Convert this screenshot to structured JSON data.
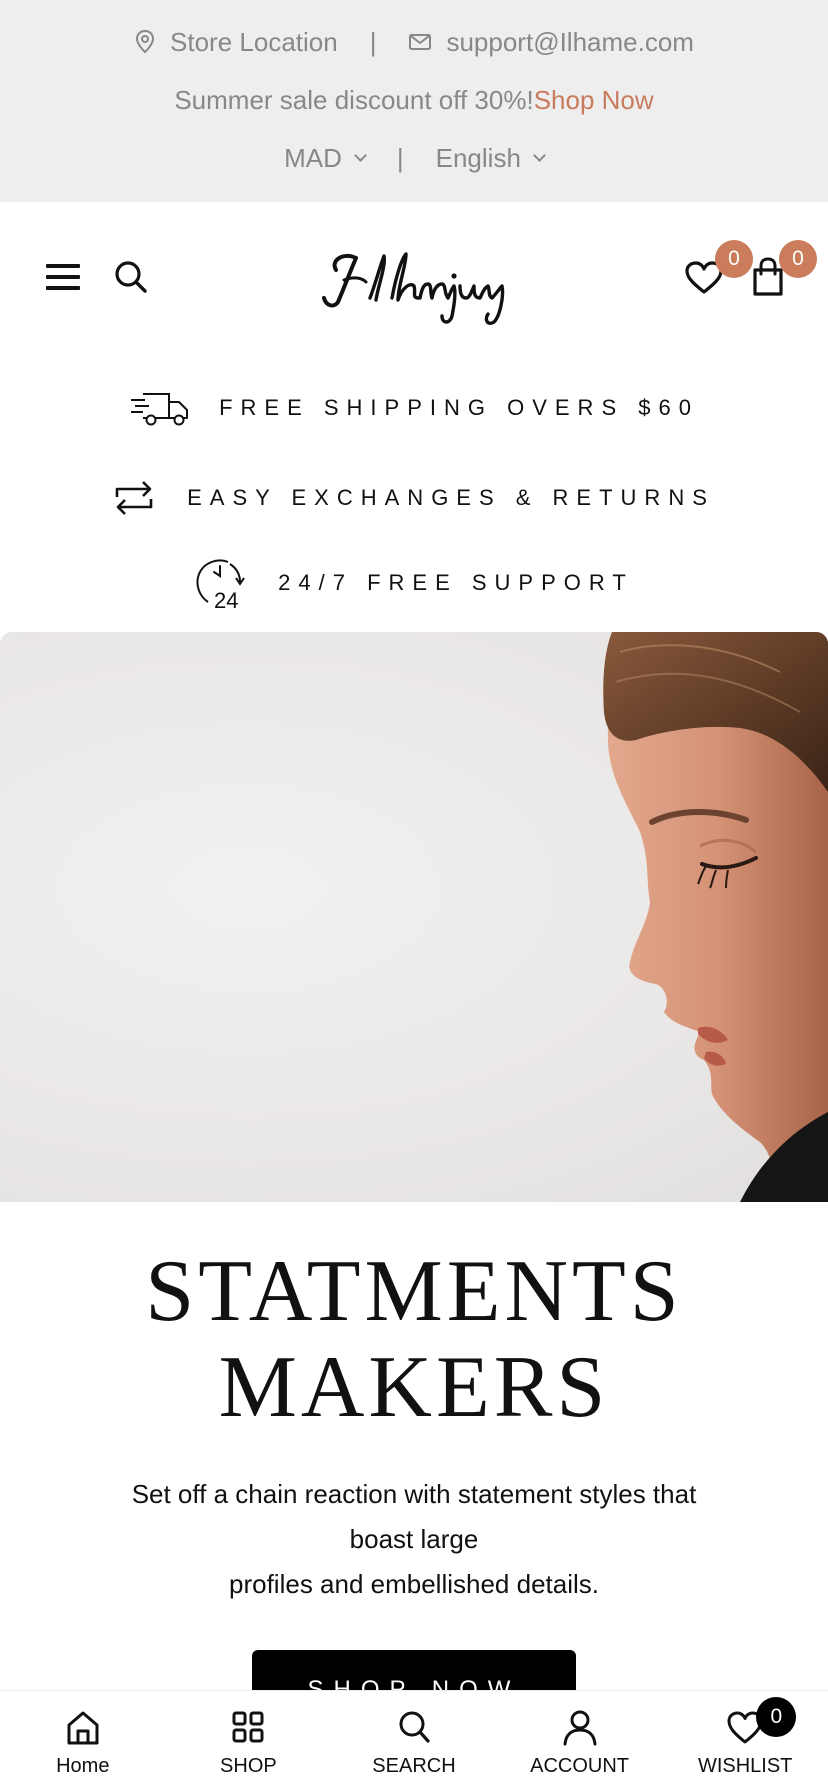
{
  "topbar": {
    "store_location": "Store Location",
    "separator": "|",
    "email": "support@Ilhame.com",
    "sale_text": "Summer sale discount off 30%!",
    "sale_link": "Shop Now",
    "currency": "MAD",
    "language": "English"
  },
  "header": {
    "logo_text": "Ilhmjury",
    "wishlist_count": "0",
    "cart_count": "0"
  },
  "features": [
    {
      "label": "FREE SHIPPING OVERS $60",
      "icon": "truck-icon"
    },
    {
      "label": "EASY EXCHANGES & RETURNS",
      "icon": "exchange-icon"
    },
    {
      "label": "24/7 FREE SUPPORT",
      "icon": "support-24-icon"
    }
  ],
  "hero": {
    "title_line1": "STATMENTS",
    "title_line2": "MAKERS",
    "desc_line1": "Set off a chain reaction with statement styles that boast large",
    "desc_line2": "profiles and embellished details.",
    "cta": "SHOP NOW"
  },
  "bottom_nav": {
    "items": [
      {
        "label": "Home",
        "icon": "home-icon"
      },
      {
        "label": "SHOP",
        "icon": "grid-icon"
      },
      {
        "label": "SEARCH",
        "icon": "search-icon"
      },
      {
        "label": "ACCOUNT",
        "icon": "user-icon"
      },
      {
        "label": "WISHLIST",
        "icon": "heart-icon"
      }
    ],
    "wishlist_badge": "0"
  },
  "colors": {
    "accent": "#cb7c5a",
    "sale_link": "#c97b5d",
    "topbar_bg": "#eeeeee",
    "button_bg": "#000000"
  }
}
